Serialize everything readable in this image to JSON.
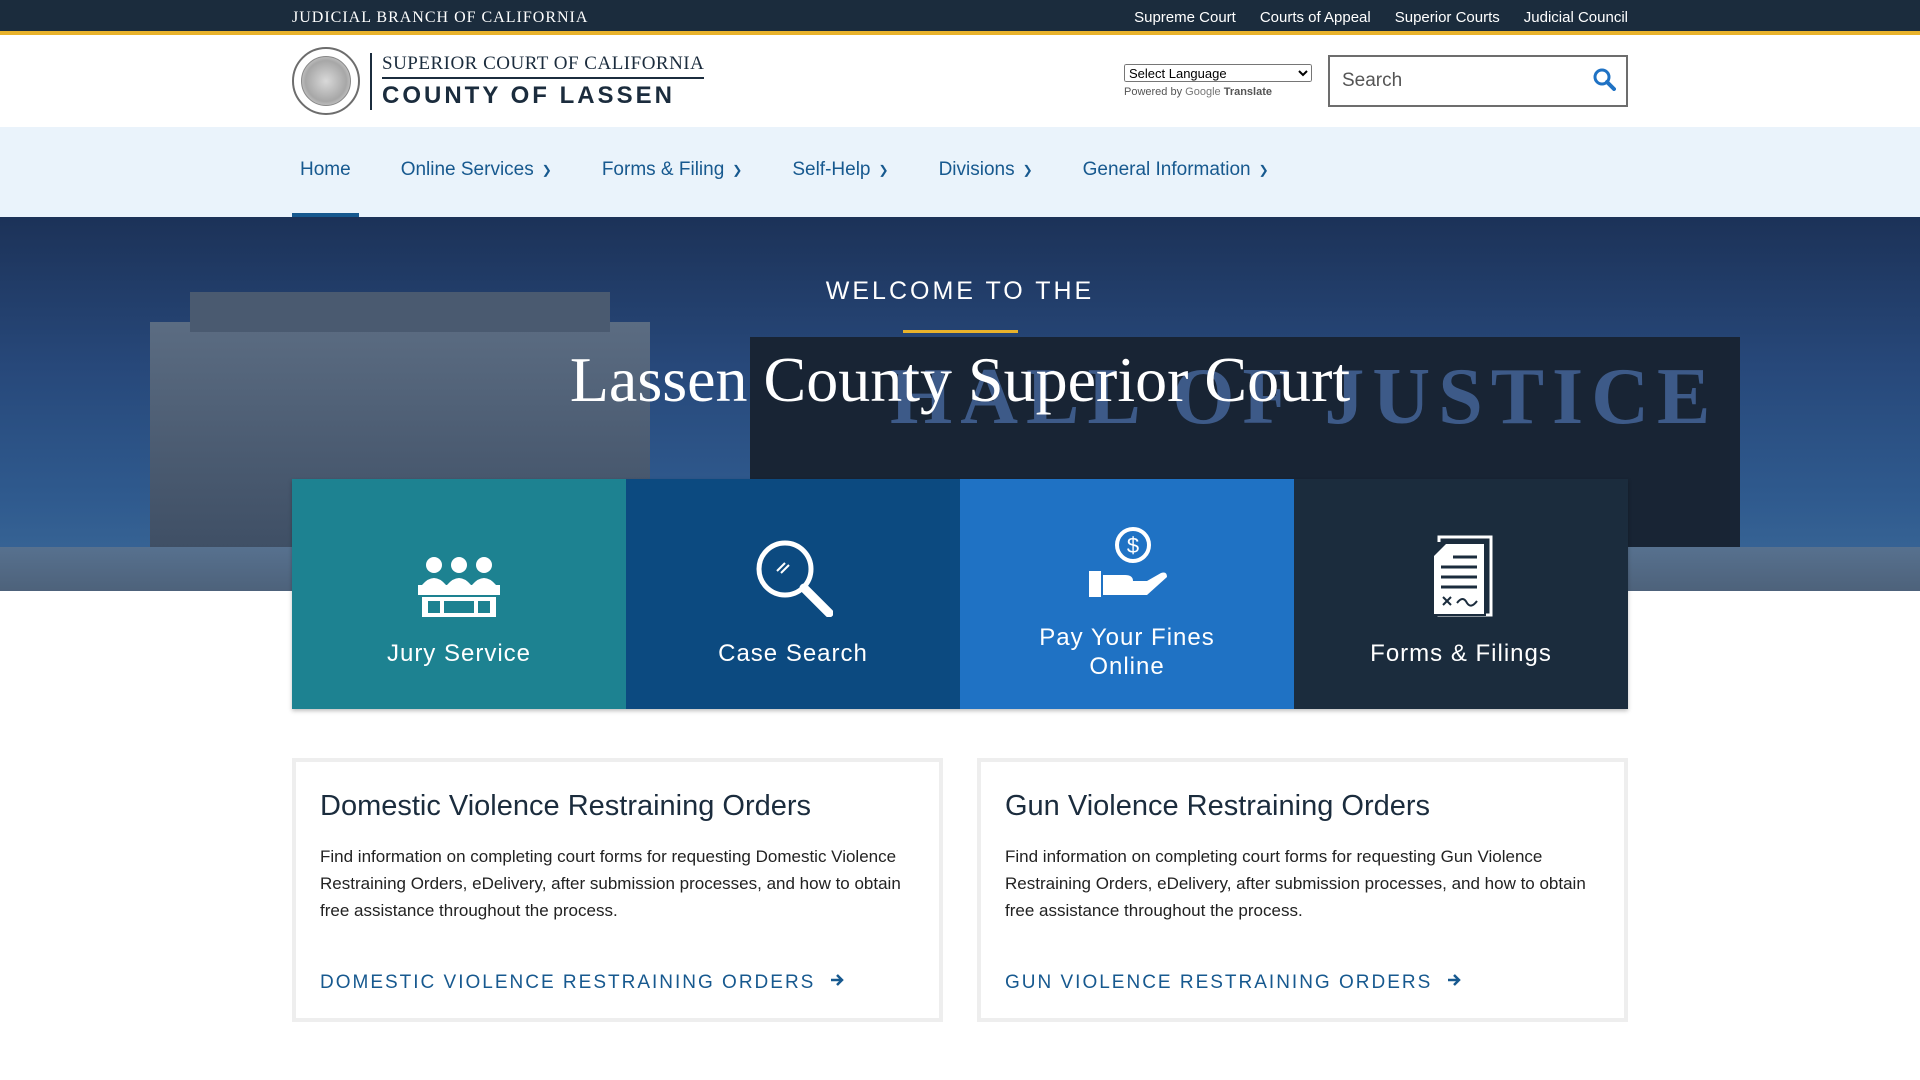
{
  "topbar": {
    "brand": "JUDICIAL BRANCH OF CALIFORNIA",
    "links": [
      "Supreme Court",
      "Courts of Appeal",
      "Superior Courts",
      "Judicial Council"
    ]
  },
  "header": {
    "logo_line1": "SUPERIOR COURT OF CALIFORNIA",
    "logo_line2": "COUNTY OF LASSEN",
    "translate_select": "Select Language",
    "powered_prefix": "Powered by",
    "powered_google": "Google",
    "powered_translate": "Translate",
    "search_placeholder": "Search"
  },
  "nav": {
    "items": [
      {
        "label": "Home",
        "active": true
      },
      {
        "label": "Online Services"
      },
      {
        "label": "Forms & Filing"
      },
      {
        "label": "Self-Help"
      },
      {
        "label": "Divisions"
      },
      {
        "label": "General Information"
      }
    ]
  },
  "hero": {
    "welcome": "WELCOME TO THE",
    "title": "Lassen County Superior Court",
    "sign_text": "HALL OF JUSTICE"
  },
  "tiles": [
    {
      "label": "Jury Service",
      "icon": "jury-icon",
      "color": "#1d8291"
    },
    {
      "label": "Case Search",
      "icon": "magnifier-icon",
      "color": "#0c4a80"
    },
    {
      "label_line1": "Pay Your Fines",
      "label_line2": "Online",
      "icon": "money-hand-icon",
      "color": "#1f72c4"
    },
    {
      "label": "Forms & Filings",
      "icon": "document-icon",
      "color": "#1b2c3d"
    }
  ],
  "cards": [
    {
      "title": "Domestic Violence Restraining Orders",
      "body": "Find information on completing court forms for requesting Domestic Violence Restraining Orders, eDelivery, after submission processes, and how to obtain free assistance throughout the process.",
      "link": "DOMESTIC VIOLENCE RESTRAINING ORDERS"
    },
    {
      "title": "Gun Violence Restraining Orders",
      "body": "Find information on completing court forms for requesting Gun Violence Restraining Orders, eDelivery, after submission processes, and how to obtain free assistance throughout the process.",
      "link": "GUN VIOLENCE RESTRAINING ORDERS"
    }
  ],
  "colors": {
    "topbar": "#1b2c3d",
    "gold_accent": "#e8b22b",
    "nav_bg": "#eaf3fb",
    "link_blue": "#17598f"
  }
}
